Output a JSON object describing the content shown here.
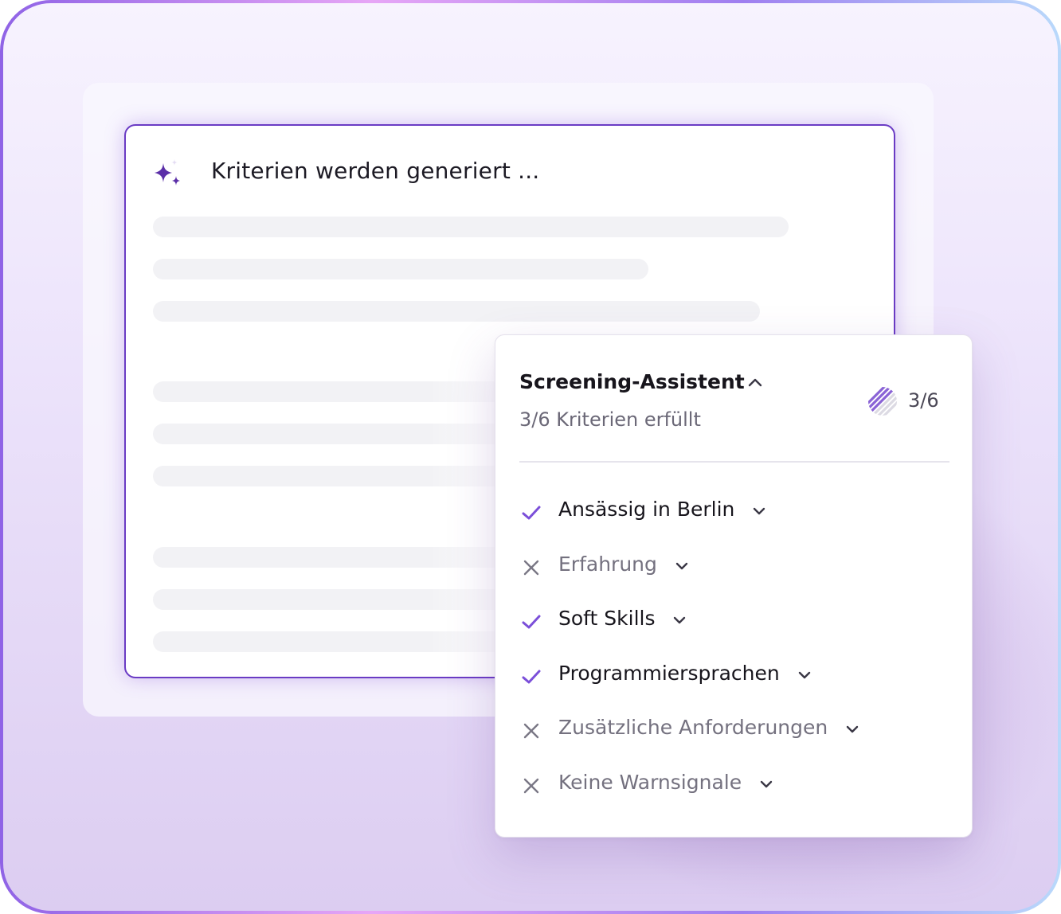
{
  "document": {
    "title": "Kriterien werden generiert ..."
  },
  "assistant": {
    "title": "Screening-Assistent",
    "subtitle": "3/6 Kriterien erfüllt",
    "count": "3/6",
    "met": 3,
    "total": 6,
    "criteria": [
      {
        "label": "Ansässig in Berlin",
        "status": "met"
      },
      {
        "label": "Erfahrung",
        "status": "not-met"
      },
      {
        "label": "Soft Skills",
        "status": "met"
      },
      {
        "label": "Programmiersprachen",
        "status": "met"
      },
      {
        "label": "Zusätzliche Anforderungen",
        "status": "not-met"
      },
      {
        "label": "Keine Warnsignale",
        "status": "not-met"
      }
    ]
  },
  "colors": {
    "accent": "#6a3bc4",
    "check": "#7b4fd9",
    "cross": "#7a7785"
  }
}
